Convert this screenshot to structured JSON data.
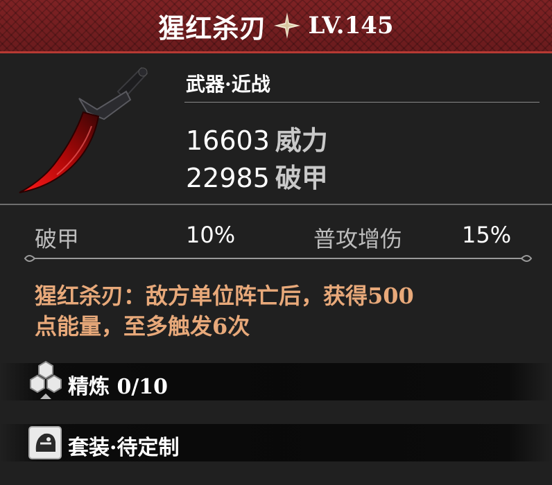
{
  "item": {
    "name": "猩红杀刃",
    "level": "LV.145",
    "category": "武器·近战",
    "stats": [
      {
        "value": "16603",
        "label": "威力"
      },
      {
        "value": "22985",
        "label": "破甲"
      }
    ],
    "attributes": [
      {
        "label": "破甲",
        "value": "10%"
      },
      {
        "label": "普攻增伤",
        "value": "15%"
      }
    ],
    "skill_text_line1": "猩红杀刃：敌方单位阵亡后，获得500",
    "skill_text_line2": "点能量，至多触发6次",
    "refine_label": "精炼 0/10",
    "set_label": "套装·待定制"
  },
  "colors": {
    "header_bg": "#7e2224",
    "accent_orange": "#e8a97a",
    "panel_bg": "#202020"
  },
  "icons": {
    "rarity": "sparkle-star-icon",
    "weapon": "crimson-blade-icon",
    "refine": "hexagon-cluster-icon",
    "set": "armor-head-icon"
  }
}
